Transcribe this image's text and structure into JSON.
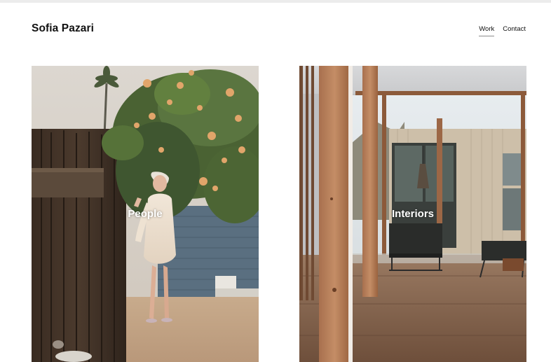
{
  "site": {
    "brand": "Sofia Pazari"
  },
  "nav": {
    "items": [
      {
        "label": "Work",
        "active": true
      },
      {
        "label": "Contact",
        "active": false
      }
    ]
  },
  "gallery": {
    "cards": [
      {
        "label": "People",
        "image": "portrait of a woman in a cream cardigan and headscarf beside a flowering bush and wooden fence"
      },
      {
        "label": "Interiors",
        "image": "modern interior with timber posts, wooden floor, black armchairs and a glass wall opening to a courtyard"
      }
    ]
  },
  "colors": {
    "text": "#111111",
    "background": "#ffffff",
    "nav_underline": "#8b8b8b",
    "label": "#ffffff"
  }
}
